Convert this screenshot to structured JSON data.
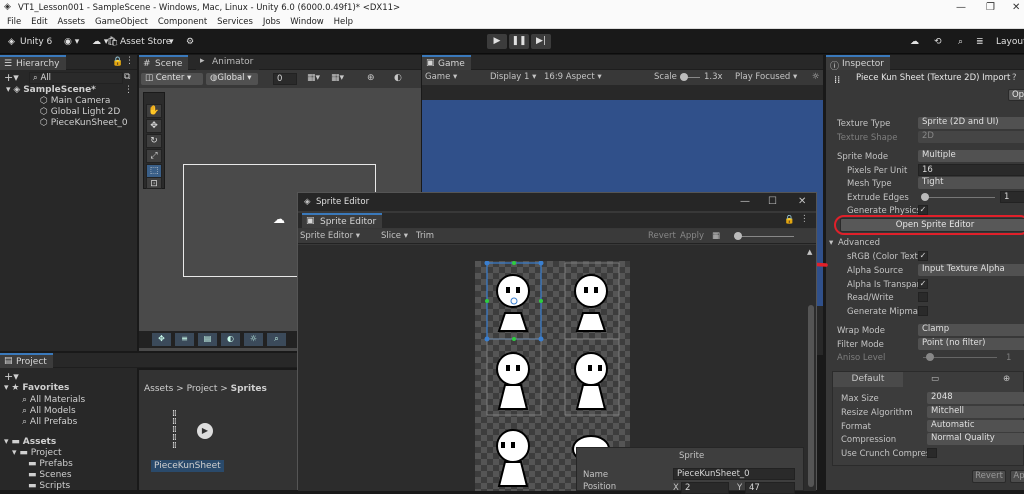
{
  "window": {
    "title": "VT1_Lesson001 - SampleScene - Windows, Mac, Linux - Unity 6.0 (6000.0.49f1)* <DX11>"
  },
  "menu": [
    "File",
    "Edit",
    "Assets",
    "GameObject",
    "Component",
    "Services",
    "Jobs",
    "Window",
    "Help"
  ],
  "toolbar": {
    "unity": "Unity 6",
    "asset_store": "Asset Store",
    "layout": "Layout"
  },
  "hierarchy": {
    "tab": "Hierarchy",
    "search_placeholder": "All",
    "scene": "SampleScene*",
    "items": [
      "Main Camera",
      "Global Light 2D",
      "PieceKunSheet_0"
    ]
  },
  "scene": {
    "tab": "Scene",
    "animator_tab": "Animator",
    "pivot": "Center",
    "space": "Global",
    "snap": "0"
  },
  "game": {
    "tab": "Game",
    "mode": "Game",
    "display": "Display 1",
    "aspect": "16:9 Aspect",
    "scale_label": "Scale",
    "scale_value": "1.3x",
    "play_focused": "Play Focused"
  },
  "inspector": {
    "tab": "Inspector",
    "title": "Piece Kun Sheet (Texture 2D) Import",
    "open_btn": "Op",
    "texture_type_label": "Texture Type",
    "texture_type": "Sprite (2D and UI)",
    "texture_shape_label": "Texture Shape",
    "texture_shape": "2D",
    "sprite_mode_label": "Sprite Mode",
    "sprite_mode": "Multiple",
    "ppu_label": "Pixels Per Unit",
    "ppu": "16",
    "mesh_type_label": "Mesh Type",
    "mesh_type": "Tight",
    "extrude_label": "Extrude Edges",
    "extrude": "1",
    "gen_physics_label": "Generate Physics",
    "open_sprite_editor": "Open Sprite Editor",
    "advanced": "Advanced",
    "srgb_label": "sRGB (Color Textu",
    "alpha_source_label": "Alpha Source",
    "alpha_source": "Input Texture Alpha",
    "alpha_transp_label": "Alpha Is Transpare",
    "read_write_label": "Read/Write",
    "gen_mipmap_label": "Generate Mipmap",
    "wrap_label": "Wrap Mode",
    "wrap": "Clamp",
    "filter_label": "Filter Mode",
    "filter": "Point (no filter)",
    "aniso_label": "Aniso Level",
    "aniso": "1",
    "platform_default": "Default",
    "max_size_label": "Max Size",
    "max_size": "2048",
    "resize_label": "Resize Algorithm",
    "resize": "Mitchell",
    "format_label": "Format",
    "format": "Automatic",
    "compression_label": "Compression",
    "compression": "Normal Quality",
    "crunch_label": "Use Crunch Compres",
    "revert": "Revert",
    "apply": "Ap"
  },
  "project": {
    "tab": "Project",
    "favorites": "Favorites",
    "fav_items": [
      "All Materials",
      "All Models",
      "All Prefabs"
    ],
    "assets": "Assets",
    "asset_items": [
      "Project",
      "Prefabs",
      "Scenes",
      "Scripts"
    ],
    "breadcrumb_assets": "Assets",
    "breadcrumb_project": "Project",
    "breadcrumb_sprites": "Sprites",
    "asset_name": "PieceKunSheet"
  },
  "sprite_editor": {
    "title": "Sprite Editor",
    "tab": "Sprite Editor",
    "mode": "Sprite Editor",
    "slice": "Slice",
    "trim": "Trim",
    "revert": "Revert",
    "apply": "Apply",
    "panel_title": "Sprite",
    "name_label": "Name",
    "name_value": "PieceKunSheet_0",
    "position_label": "Position",
    "x_label": "X",
    "x_value": "2",
    "y_label": "Y",
    "y_value": "47"
  },
  "colors": {
    "accent": "#3a79bb",
    "annotation": "#e0202a",
    "game_bg": "#30508a"
  }
}
